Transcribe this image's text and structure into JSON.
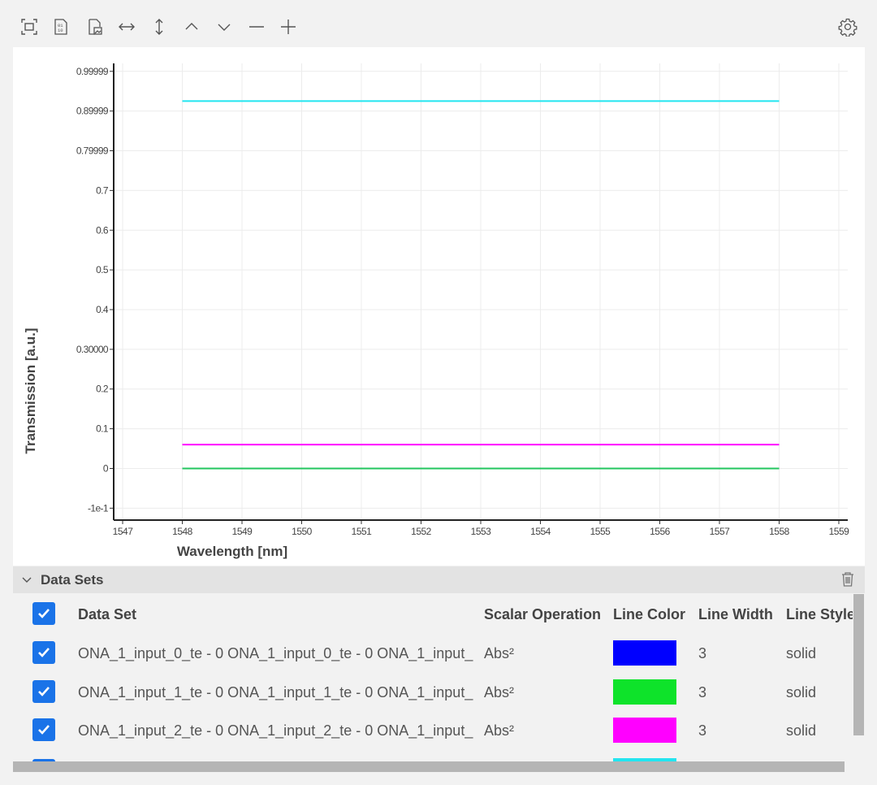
{
  "toolbar": {
    "icons": [
      "fit-view-icon",
      "export-data-icon",
      "export-image-icon",
      "zoom-x-icon",
      "zoom-y-icon",
      "move-up-icon",
      "move-down-icon",
      "zoom-out-icon",
      "zoom-in-icon",
      "settings-icon"
    ]
  },
  "chart_data": {
    "type": "line",
    "xlabel": "Wavelength [nm]",
    "ylabel": "Transmission [a.u.]",
    "xlim": [
      1546.85,
      1559.15
    ],
    "ylim": [
      -0.13,
      1.02
    ],
    "x_ticks": [
      1547,
      1548,
      1549,
      1550,
      1551,
      1552,
      1553,
      1554,
      1555,
      1556,
      1557,
      1558,
      1559
    ],
    "y_ticks": [
      {
        "value": -0.1,
        "label": "-1e-1"
      },
      {
        "value": 0,
        "label": "0"
      },
      {
        "value": 0.1,
        "label": "0.1"
      },
      {
        "value": 0.2,
        "label": "0.2"
      },
      {
        "value": 0.3,
        "label": "0.30000"
      },
      {
        "value": 0.4,
        "label": "0.4"
      },
      {
        "value": 0.5,
        "label": "0.5"
      },
      {
        "value": 0.6,
        "label": "0.6"
      },
      {
        "value": 0.7,
        "label": "0.7"
      },
      {
        "value": 0.8,
        "label": "0.79999"
      },
      {
        "value": 0.9,
        "label": "0.89999"
      },
      {
        "value": 1.0,
        "label": "0.99999"
      }
    ],
    "grid": true,
    "series": [
      {
        "x": [
          1548,
          1558
        ],
        "y": [
          0.0,
          0.0
        ],
        "color": "#0000ff"
      },
      {
        "x": [
          1548,
          1558
        ],
        "y": [
          0.0,
          0.0
        ],
        "color": "#22c55e"
      },
      {
        "x": [
          1548,
          1558
        ],
        "y": [
          0.06,
          0.06
        ],
        "color": "#ff00ff"
      },
      {
        "x": [
          1548,
          1558
        ],
        "y": [
          0.925,
          0.925
        ],
        "color": "#22e5f0"
      }
    ]
  },
  "datasets": {
    "title": "Data Sets",
    "columns": {
      "name": "Data Set",
      "operation": "Scalar Operation",
      "color": "Line Color",
      "width": "Line Width",
      "style": "Line Style"
    },
    "rows": [
      {
        "name": "ONA_1_input_0_te - 0 ONA_1_input_0_te - 0 ONA_1_input_",
        "operation": "Abs²",
        "color": "#0000ff",
        "width": "3",
        "style": "solid",
        "checked": true
      },
      {
        "name": "ONA_1_input_1_te - 0 ONA_1_input_1_te - 0 ONA_1_input_",
        "operation": "Abs²",
        "color": "#0ee32a",
        "width": "3",
        "style": "solid",
        "checked": true
      },
      {
        "name": "ONA_1_input_2_te - 0 ONA_1_input_2_te - 0 ONA_1_input_",
        "operation": "Abs²",
        "color": "#ff00ff",
        "width": "3",
        "style": "solid",
        "checked": true
      },
      {
        "name": "",
        "operation": "",
        "color": "#22e5f0",
        "width": "",
        "style": "",
        "checked": true
      }
    ]
  }
}
